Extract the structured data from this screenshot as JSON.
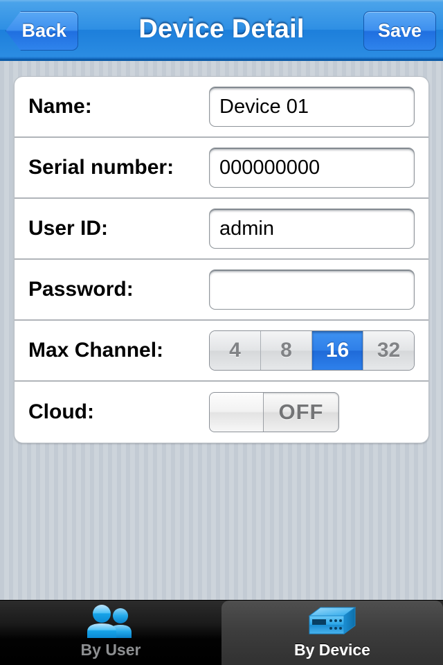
{
  "navbar": {
    "back_label": "Back",
    "title": "Device Detail",
    "save_label": "Save",
    "accent_color": "#2e8fe4"
  },
  "form": {
    "rows": [
      {
        "label": "Name:",
        "type": "text",
        "value": "Device 01",
        "placeholder": ""
      },
      {
        "label": "Serial number:",
        "type": "text",
        "value": "000000000",
        "placeholder": ""
      },
      {
        "label": "User ID:",
        "type": "text",
        "value": "admin",
        "placeholder": ""
      },
      {
        "label": "Password:",
        "type": "password",
        "value": "",
        "placeholder": ""
      },
      {
        "label": "Max Channel:",
        "type": "segmented",
        "value": "16"
      },
      {
        "label": "Cloud:",
        "type": "toggle",
        "value": "OFF"
      }
    ],
    "max_channel": {
      "options": [
        "4",
        "8",
        "16",
        "32"
      ],
      "selected": "16",
      "selected_color": "#2f7fe8"
    },
    "cloud": {
      "state_label": "OFF",
      "on": false
    }
  },
  "tabbar": {
    "tabs": [
      {
        "label": "By User",
        "icon": "people-icon",
        "active": false
      },
      {
        "label": "By Device",
        "icon": "device-box-icon",
        "active": true
      }
    ]
  }
}
